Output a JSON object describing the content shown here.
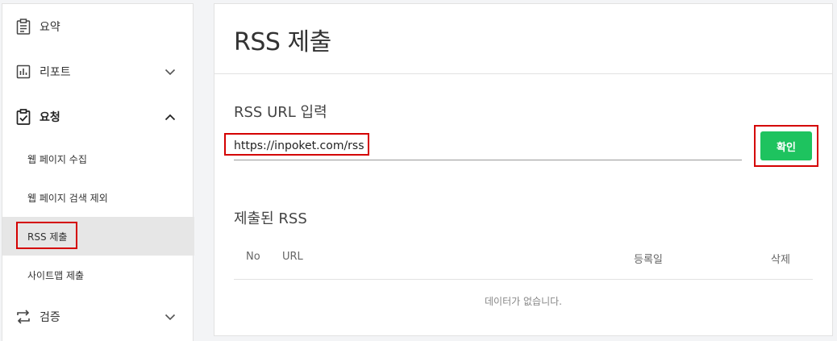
{
  "sidebar": {
    "items": [
      {
        "label": "요약",
        "icon": "clipboard-icon"
      },
      {
        "label": "리포트",
        "icon": "bar-chart-icon"
      },
      {
        "label": "요청",
        "icon": "clipboard-check-icon"
      },
      {
        "label": "검증",
        "icon": "swap-arrows-icon"
      }
    ],
    "sub_items": [
      {
        "label": "웹 페이지 수집"
      },
      {
        "label": "웹 페이지 검색 제외"
      },
      {
        "label": "RSS 제출"
      },
      {
        "label": "사이트맵 제출"
      }
    ]
  },
  "main": {
    "title": "RSS 제출",
    "input_section_label": "RSS URL 입력",
    "url_value": "https://inpoket.com/rss",
    "confirm_label": "확인",
    "submitted_section_label": "제출된 RSS",
    "table": {
      "columns": [
        "No",
        "URL",
        "등록일",
        "삭제"
      ],
      "empty_message": "데이터가 없습니다."
    }
  },
  "colors": {
    "accent_green": "#1ec35f",
    "highlight_red": "#d40000",
    "active_bg": "#e6e6e6"
  }
}
